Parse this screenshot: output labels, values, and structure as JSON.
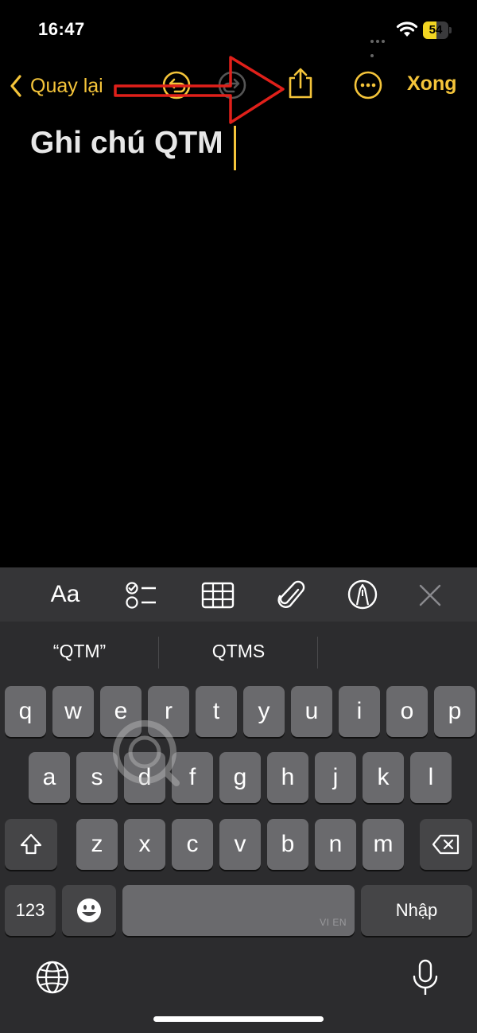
{
  "status_bar": {
    "time": "16:47",
    "battery": "54",
    "battery_level": 0.54
  },
  "nav": {
    "back_label": "Quay lại",
    "done_label": "Xong"
  },
  "note": {
    "title": "Ghi chú QTM"
  },
  "toolbar": {
    "format_label": "Aa"
  },
  "suggestions": [
    "“QTM”",
    "QTMS"
  ],
  "keyboard": {
    "row1": [
      "q",
      "w",
      "e",
      "r",
      "t",
      "y",
      "u",
      "i",
      "o",
      "p"
    ],
    "row2": [
      "a",
      "s",
      "d",
      "f",
      "g",
      "h",
      "j",
      "k",
      "l"
    ],
    "row3": [
      "z",
      "x",
      "c",
      "v",
      "b",
      "n",
      "m"
    ],
    "numbers_label": "123",
    "space_lang_label": "VI EN",
    "return_label": "Nhập"
  },
  "colors": {
    "accent": "#f4c43a",
    "annotation_arrow": "#e0201a"
  }
}
